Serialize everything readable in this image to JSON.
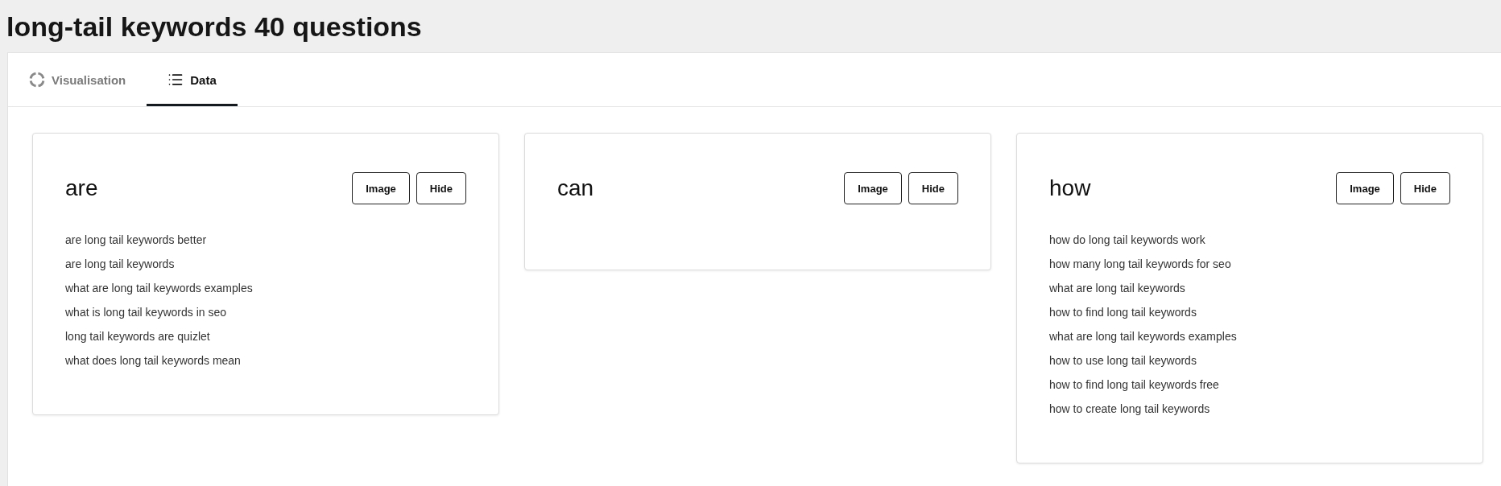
{
  "page": {
    "title": "long-tail keywords 40 questions"
  },
  "tabs": [
    {
      "label": "Visualisation",
      "selected": false
    },
    {
      "label": "Data",
      "selected": true
    }
  ],
  "groups": [
    {
      "heading": "are",
      "buttons": [
        "Image",
        "Hide"
      ],
      "questions": [
        "are long tail keywords better",
        "are long tail keywords",
        "what are long tail keywords examples",
        "what is long tail keywords in seo",
        "long tail keywords are quizlet",
        "what does long tail keywords mean"
      ]
    },
    {
      "heading": "can",
      "buttons": [
        "Image",
        "Hide"
      ]
    },
    {
      "heading": "how",
      "buttons": [
        "Image",
        "Hide"
      ],
      "questions": [
        "how do long tail keywords work",
        "how many long tail keywords for seo",
        "what are long tail keywords",
        "how to find long tail keywords",
        "what are long tail keywords examples",
        "how to use long tail keywords",
        "how to find long tail keywords free",
        "how to create long tail keywords"
      ]
    }
  ]
}
